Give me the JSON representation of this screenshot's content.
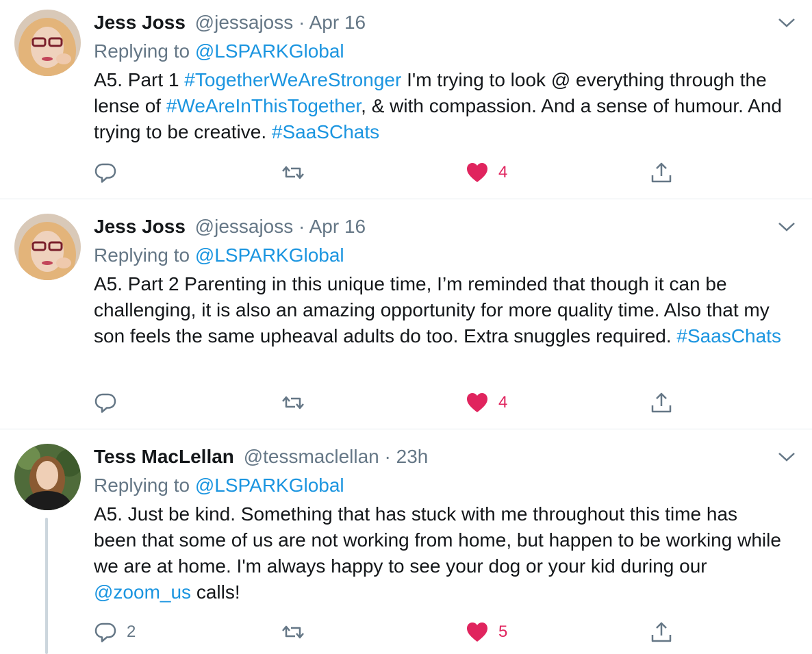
{
  "colors": {
    "link": "#1b95e0",
    "muted": "#657786",
    "like": "#e0245e",
    "divider": "#e6ecf0"
  },
  "tweets": [
    {
      "name": "Jess Joss",
      "handle": "@jessajoss",
      "separator": "·",
      "time": "Apr 16",
      "replying_prefix": "Replying to",
      "replying_to": "@LSPARKGlobal",
      "body": [
        {
          "t": "A5. Part 1 "
        },
        {
          "t": "#TogetherWeAreStronger",
          "link": true
        },
        {
          "t": " I'm trying to look @ everything through the lense of "
        },
        {
          "t": "#WeAreInThisTogether",
          "link": true
        },
        {
          "t": ", & with compassion. And a sense of humour. And trying to be creative. "
        },
        {
          "t": "#SaaSChats",
          "link": true
        }
      ],
      "reply_count": "",
      "retweet_count": "",
      "like_count": "4",
      "liked": true,
      "icons": [
        "reply-icon",
        "retweet-icon",
        "heart-icon",
        "share-icon",
        "chevron-down-icon"
      ]
    },
    {
      "name": "Jess Joss",
      "handle": "@jessajoss",
      "separator": "·",
      "time": "Apr 16",
      "replying_prefix": "Replying to",
      "replying_to": "@LSPARKGlobal",
      "body": [
        {
          "t": "A5. Part 2 Parenting in this unique time, I’m reminded that though it can be challenging, it is also an amazing opportunity for more quality time. Also that my son feels the same upheaval adults do too. Extra snuggles required.  "
        },
        {
          "t": "#SaasChats",
          "link": true
        }
      ],
      "reply_count": "",
      "retweet_count": "",
      "like_count": "4",
      "liked": true
    },
    {
      "name": "Tess MacLellan",
      "handle": "@tessmaclellan",
      "separator": "·",
      "time": "23h",
      "replying_prefix": "Replying to",
      "replying_to": "@LSPARKGlobal",
      "body": [
        {
          "t": "A5. Just be kind. Something that has stuck with me throughout this time has been that some of us are not working from home, but happen to be working while we are at home. I'm always happy to see your dog or your kid during our "
        },
        {
          "t": "@zoom_us",
          "link": true
        },
        {
          "t": " calls!"
        }
      ],
      "reply_count": "2",
      "retweet_count": "",
      "like_count": "5",
      "liked": true
    }
  ]
}
